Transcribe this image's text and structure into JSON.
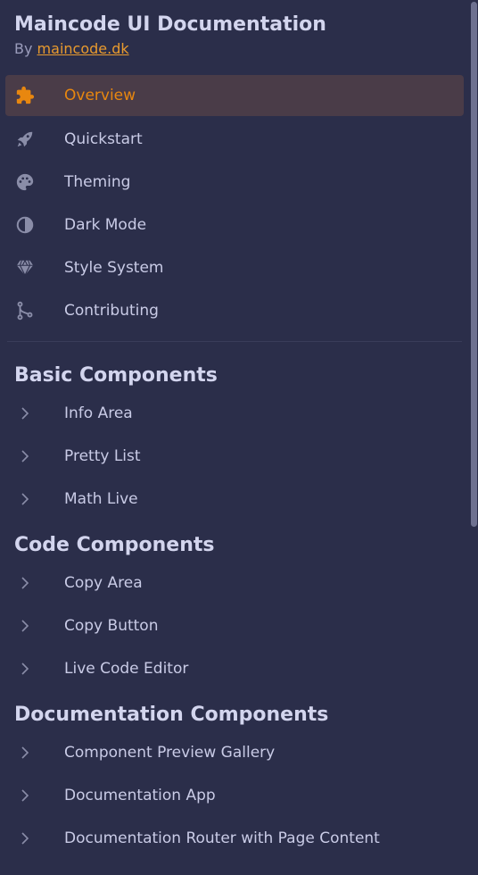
{
  "app": {
    "title": "Maincode UI Documentation",
    "byline_prefix": "By",
    "byline_link": "maincode.dk"
  },
  "colors": {
    "background": "#2b2e4a",
    "accent": "#e8870f",
    "active_bg": "#4a3c48",
    "text": "#c9cbe6",
    "muted_icon": "#8a8da8"
  },
  "nav": {
    "items": [
      {
        "label": "Overview",
        "icon": "puzzle-icon",
        "active": true
      },
      {
        "label": "Quickstart",
        "icon": "rocket-icon"
      },
      {
        "label": "Theming",
        "icon": "palette-icon"
      },
      {
        "label": "Dark Mode",
        "icon": "contrast-icon"
      },
      {
        "label": "Style System",
        "icon": "gem-icon"
      },
      {
        "label": "Contributing",
        "icon": "git-branch-icon"
      }
    ]
  },
  "sections": [
    {
      "title": "Basic Components",
      "items": [
        {
          "label": "Info Area"
        },
        {
          "label": "Pretty List"
        },
        {
          "label": "Math Live"
        }
      ]
    },
    {
      "title": "Code Components",
      "items": [
        {
          "label": "Copy Area"
        },
        {
          "label": "Copy Button"
        },
        {
          "label": "Live Code Editor"
        }
      ]
    },
    {
      "title": "Documentation Components",
      "items": [
        {
          "label": "Component Preview Gallery"
        },
        {
          "label": "Documentation App"
        },
        {
          "label": "Documentation Router with Page Content"
        }
      ]
    }
  ]
}
